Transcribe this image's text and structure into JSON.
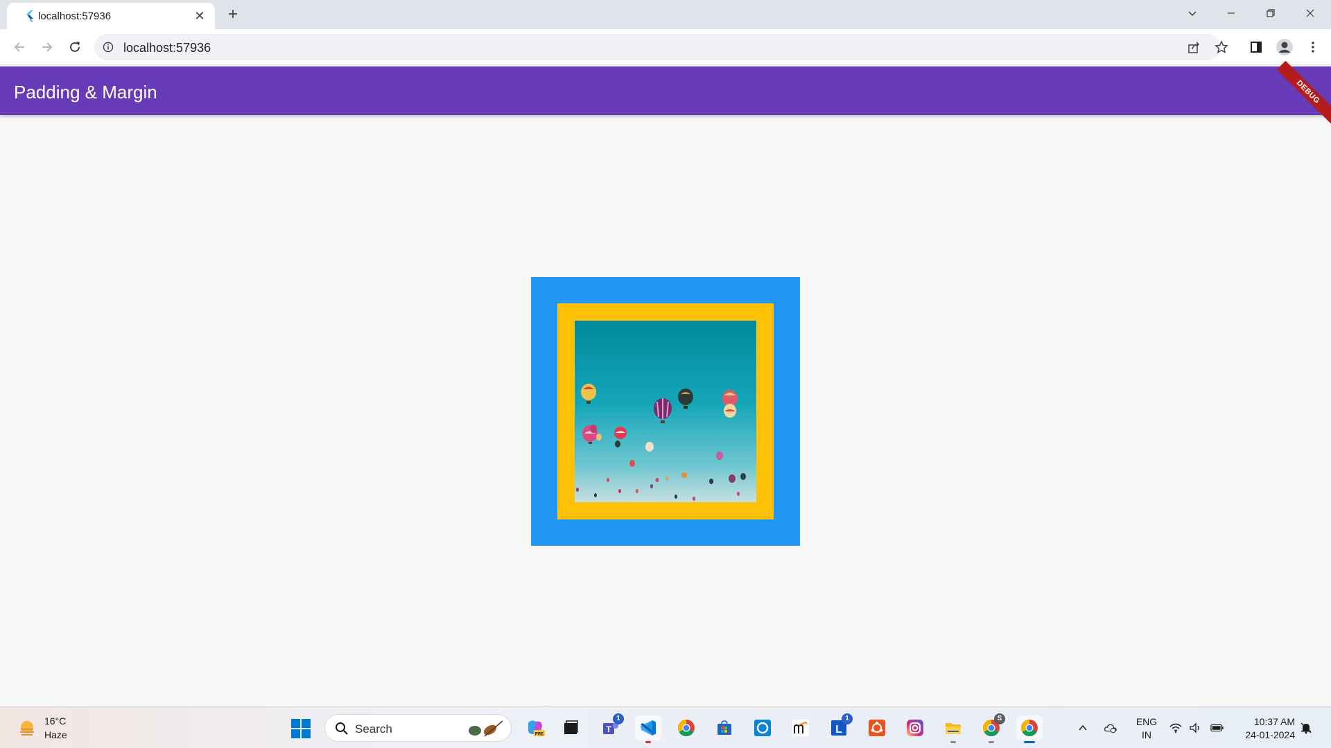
{
  "browser": {
    "tab_title": "localhost:57936",
    "tab_close_glyph": "✕",
    "new_tab_glyph": "+",
    "url": "localhost:57936"
  },
  "app": {
    "title": "Padding & Margin",
    "debug_banner": "DEBUG",
    "colors": {
      "appbar": "#673ab7",
      "outer_container": "#2196f3",
      "inner_container": "#ffc107"
    },
    "image_description": "hot air balloons in blue sky"
  },
  "taskbar": {
    "weather_temp": "16°C",
    "weather_condition": "Haze",
    "search_placeholder": "Search",
    "teams_badge": "1",
    "lens_badge": "1",
    "lens_letter": "L",
    "chrome_profile_badge": "S",
    "lang_line1": "ENG",
    "lang_line2": "IN",
    "time": "10:37 AM",
    "date": "24-01-2024"
  },
  "icons": [
    "flutter-icon",
    "back-icon",
    "forward-icon",
    "reload-icon",
    "info-icon",
    "share-icon",
    "star-icon",
    "side-panel-icon",
    "profile-icon",
    "menu-icon",
    "windows-start-icon",
    "search-icon"
  ]
}
